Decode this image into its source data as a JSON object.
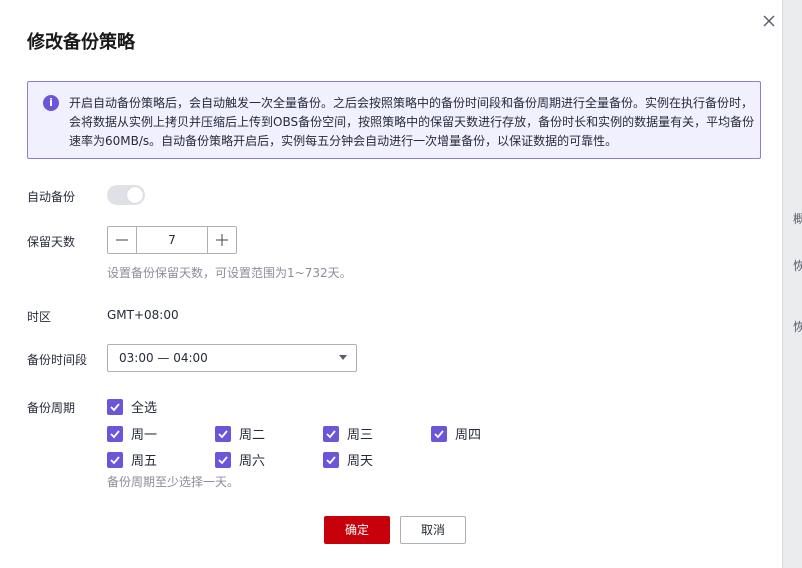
{
  "dialog": {
    "title": "修改备份策略",
    "notice": "开启自动备份策略后，会自动触发一次全量备份。之后会按照策略中的备份时间段和备份周期进行全量备份。实例在执行备份时，会将数据从实例上拷贝并压缩后上传到OBS备份空间，按照策略中的保留天数进行存放，备份时长和实例的数据量有关，平均备份速率为60MB/s。自动备份策略开启后，实例每五分钟会自动进行一次增量备份，以保证数据的可靠性。"
  },
  "form": {
    "auto_backup": {
      "label": "自动备份",
      "enabled": true
    },
    "retention": {
      "label": "保留天数",
      "value": "7",
      "hint": "设置备份保留天数，可设置范围为1~732天。"
    },
    "timezone": {
      "label": "时区",
      "value": "GMT+08:00"
    },
    "backup_window": {
      "label": "备份时间段",
      "value": "03:00 — 04:00"
    },
    "backup_cycle": {
      "label": "备份周期",
      "select_all": "全选",
      "days": [
        "周一",
        "周二",
        "周三",
        "周四",
        "周五",
        "周六",
        "周天"
      ],
      "hint": "备份周期至少选择一天。"
    }
  },
  "buttons": {
    "confirm": "确定",
    "cancel": "取消"
  },
  "background": {
    "fragments": [
      "概",
      "恢",
      "恢"
    ]
  },
  "colors": {
    "accent": "#6b55d8",
    "primary_button": "#c7000b",
    "notice_bg": "#f1f0fe"
  },
  "icons": {
    "close": "close-icon",
    "info": "info-icon",
    "check": "check-icon",
    "caret": "caret-down-icon"
  }
}
